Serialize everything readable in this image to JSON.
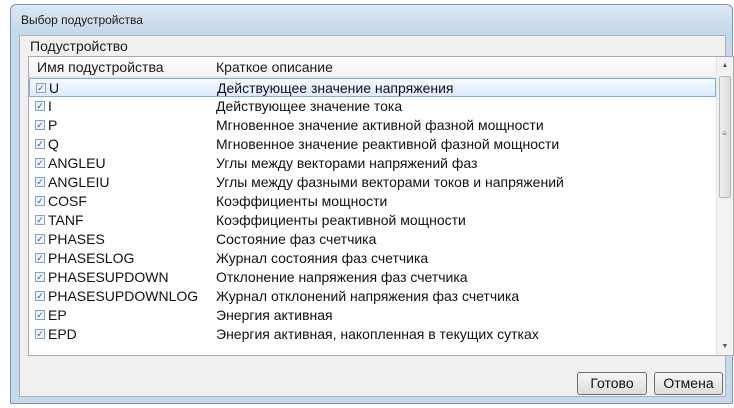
{
  "window": {
    "title": "Выбор подустройства"
  },
  "group": {
    "title": "Подустройство"
  },
  "columns": {
    "name": "Имя подустройства",
    "description": "Краткое описание"
  },
  "rows": [
    {
      "name": "U",
      "description": "Действующее значение напряжения",
      "checked": true,
      "selected": true
    },
    {
      "name": "I",
      "description": "Действующее значение тока",
      "checked": true
    },
    {
      "name": "P",
      "description": "Мгновенное значение активной фазной мощности",
      "checked": true
    },
    {
      "name": "Q",
      "description": "Мгновенное значение реактивной фазной мощности",
      "checked": true
    },
    {
      "name": "ANGLEU",
      "description": "Углы между векторами напряжений фаз",
      "checked": true
    },
    {
      "name": "ANGLEIU",
      "description": "Углы между фазными векторами токов и напряжений",
      "checked": true
    },
    {
      "name": "COSF",
      "description": "Коэффициенты мощности",
      "checked": true
    },
    {
      "name": "TANF",
      "description": "Коэффициенты реактивной мощности",
      "checked": true
    },
    {
      "name": "PHASES",
      "description": "Состояние фаз счетчика",
      "checked": true
    },
    {
      "name": "PHASESLOG",
      "description": "Журнал состояния фаз счетчика",
      "checked": true
    },
    {
      "name": "PHASESUPDOWN",
      "description": "Отклонение напряжения фаз счетчика",
      "checked": true
    },
    {
      "name": "PHASESUPDOWNLOG",
      "description": "Журнал отклонений напряжения фаз счетчика",
      "checked": true
    },
    {
      "name": "EP",
      "description": "Энергия активная",
      "checked": true
    },
    {
      "name": "EPD",
      "description": "Энергия активная, накопленная в текущих сутках",
      "checked": true
    }
  ],
  "buttons": {
    "ok": "Готово",
    "cancel": "Отмена"
  },
  "icons": {
    "scroll_up": "arrow-up-icon",
    "scroll_down": "arrow-down-icon",
    "check": "checkmark-icon"
  },
  "colors": {
    "selection_border": "#84acdd",
    "window_frame": "#c9d9ec"
  }
}
